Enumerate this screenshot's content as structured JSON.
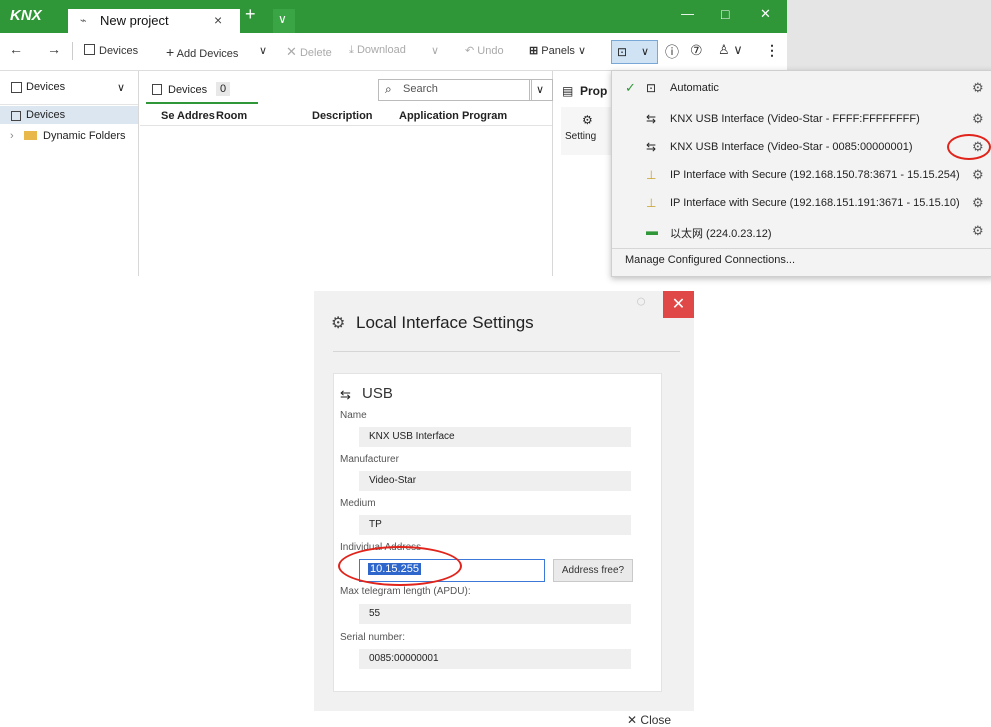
{
  "app": {
    "logo": "KNX",
    "tab_title": "New project",
    "tab_close": "×",
    "new_tab": "+",
    "window_controls": {
      "minimize": "—",
      "maximize": "□",
      "close": "✕"
    }
  },
  "toolbar": {
    "back": "←",
    "forward": "→",
    "devices_label": "Devices",
    "add_devices_label": "Add Devices",
    "delete_label": "Delete",
    "download_label": "Download",
    "undo_label": "Undo",
    "panels_label": "Panels"
  },
  "left_pane": {
    "header": "Devices",
    "selected_item": "Devices",
    "folder_item": "Dynamic Folders"
  },
  "devices_panel": {
    "tab_label": "Devices",
    "count": "0",
    "search_placeholder": "Search",
    "columns": [
      "Se",
      "Addres",
      "Room",
      "Description",
      "Application Program"
    ]
  },
  "properties": {
    "title": "Prop",
    "settings_label": "Setting"
  },
  "interface_dropdown": {
    "items": [
      {
        "label": "Automatic",
        "checked": true,
        "icon": "automatic-icon"
      },
      {
        "label": "KNX USB Interface (Video-Star - FFFF:FFFFFFFF)",
        "icon": "usb-icon"
      },
      {
        "label": "KNX USB Interface (Video-Star - 0085:00000001)",
        "icon": "usb-icon",
        "highlighted": true
      },
      {
        "label": "IP Interface with Secure (192.168.150.78:3671 - 15.15.254)",
        "icon": "ip-icon"
      },
      {
        "label": "IP Interface with Secure (192.168.151.191:3671 - 15.15.10)",
        "icon": "ip-icon"
      },
      {
        "label": "以太网 (224.0.23.12)",
        "icon": "ethernet-icon"
      }
    ],
    "manage_label": "Manage Configured Connections..."
  },
  "dialog": {
    "title": "Local Interface Settings",
    "section_title": "USB",
    "fields": {
      "name_label": "Name",
      "name_value": "KNX USB Interface",
      "manufacturer_label": "Manufacturer",
      "manufacturer_value": "Video-Star",
      "medium_label": "Medium",
      "medium_value": "TP",
      "address_label": "Individual Address",
      "address_value": "10.15.255",
      "address_button": "Address free?",
      "apdu_label": "Max telegram length (APDU):",
      "apdu_value": "55",
      "serial_label": "Serial number:",
      "serial_value": "0085:00000001"
    },
    "close_label": "Close"
  },
  "colors": {
    "ets_green": "#2f9738",
    "dialog_close_red": "#e04848",
    "annotation_red": "#e0241b",
    "selection_blue": "#2f66cc"
  }
}
